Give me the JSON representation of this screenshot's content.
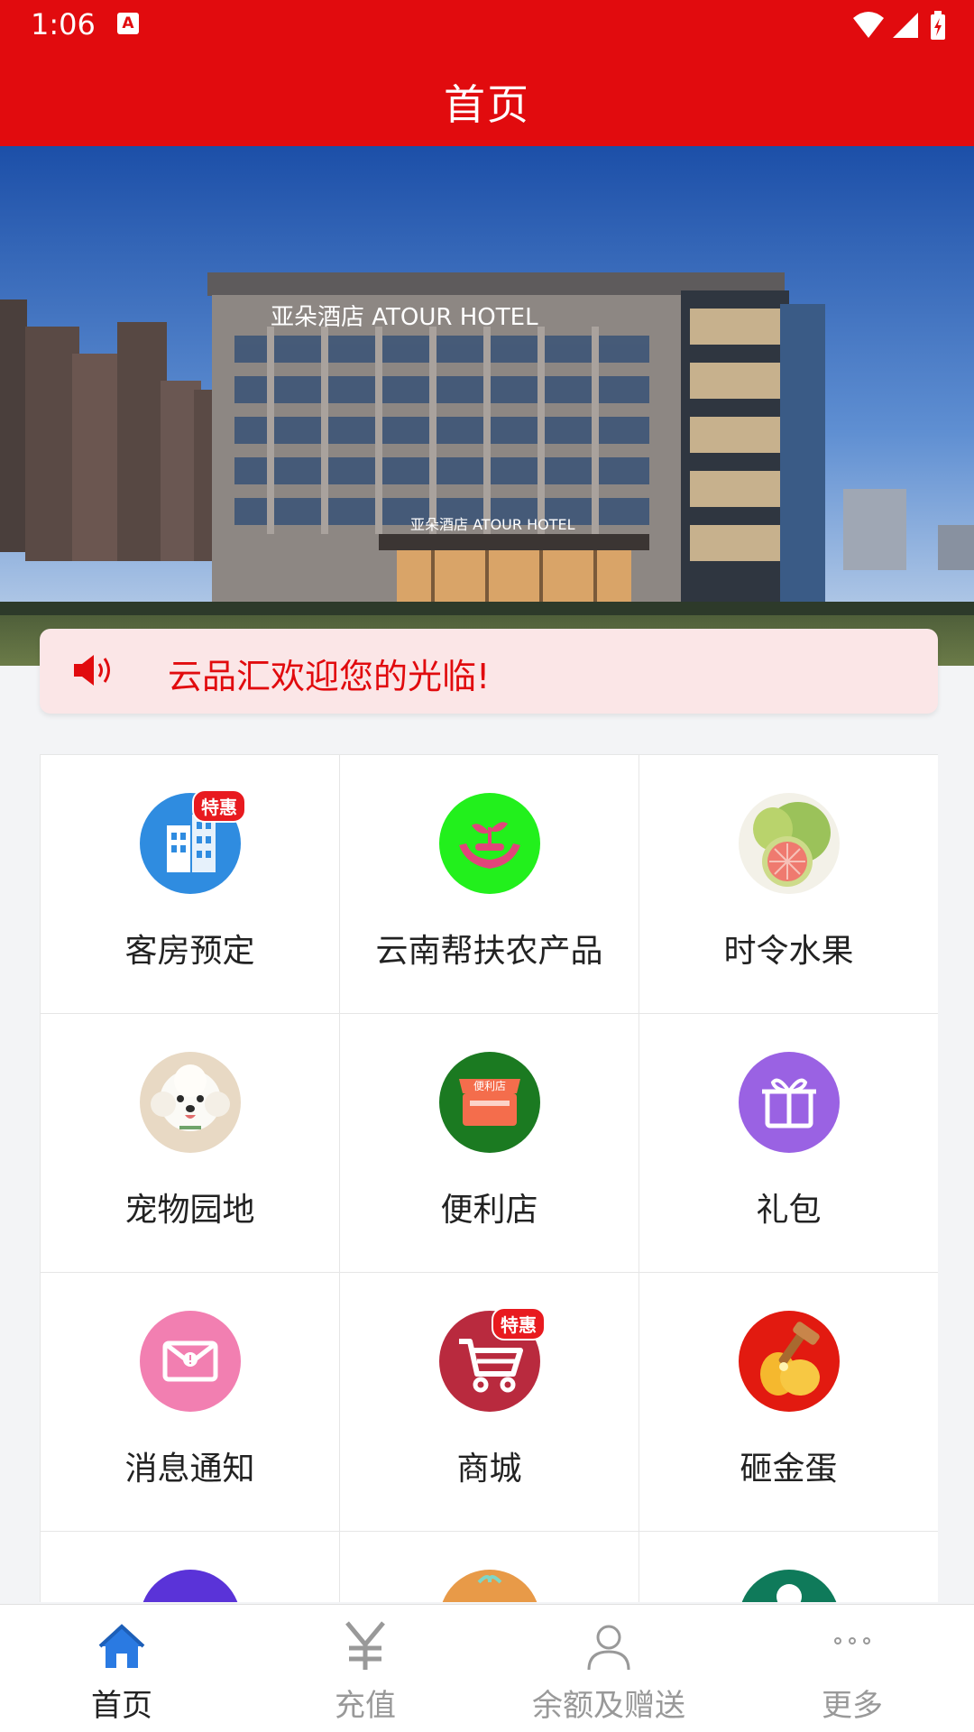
{
  "status_bar": {
    "time": "1:06",
    "notification_icon": "A"
  },
  "app_bar": {
    "title": "首页"
  },
  "banner": {
    "sign_top": "亚朵酒店 ATOUR HOTEL",
    "sign_entrance": "亚朵酒店 ATOUR HOTEL"
  },
  "notice": {
    "icon": "speaker-icon",
    "text": "云品汇欢迎您的光临!"
  },
  "grid": {
    "items": [
      {
        "label": "客房预定",
        "icon": "hotel-building-icon",
        "badge": "特惠",
        "color": "#2f8ce0"
      },
      {
        "label": "云南帮扶农产品",
        "icon": "hands-sprout-icon",
        "badge": "",
        "color": "#22f01c"
      },
      {
        "label": "时令水果",
        "icon": "pomelo-fruit-icon",
        "badge": "",
        "color": "#9bc25a"
      },
      {
        "label": "宠物园地",
        "icon": "pet-dog-icon",
        "badge": "",
        "color": "#f2eee8"
      },
      {
        "label": "便利店",
        "icon": "convenience-store-icon",
        "badge": "",
        "color": "#1b7a21"
      },
      {
        "label": "礼包",
        "icon": "gift-box-icon",
        "badge": "",
        "color": "#9a62e3"
      },
      {
        "label": "消息通知",
        "icon": "envelope-icon",
        "badge": "",
        "color": "#f27fb1"
      },
      {
        "label": "商城",
        "icon": "shopping-cart-icon",
        "badge": "特惠",
        "color": "#b92a3e"
      },
      {
        "label": "砸金蛋",
        "icon": "golden-egg-icon",
        "badge": "",
        "color": "#e21a10"
      }
    ],
    "store_sign": "便利店"
  },
  "tab_bar": {
    "tabs": [
      {
        "label": "首页",
        "icon": "home-icon",
        "active": true
      },
      {
        "label": "充值",
        "icon": "yen-icon",
        "active": false
      },
      {
        "label": "余额及赠送",
        "icon": "person-icon",
        "active": false
      },
      {
        "label": "更多",
        "icon": "more-dots-icon",
        "active": false
      }
    ]
  },
  "colors": {
    "primary": "#e10b0e",
    "notice_bg": "#fbe6e7",
    "tab_active": "#2a7ae2",
    "tab_inactive": "#999999"
  }
}
